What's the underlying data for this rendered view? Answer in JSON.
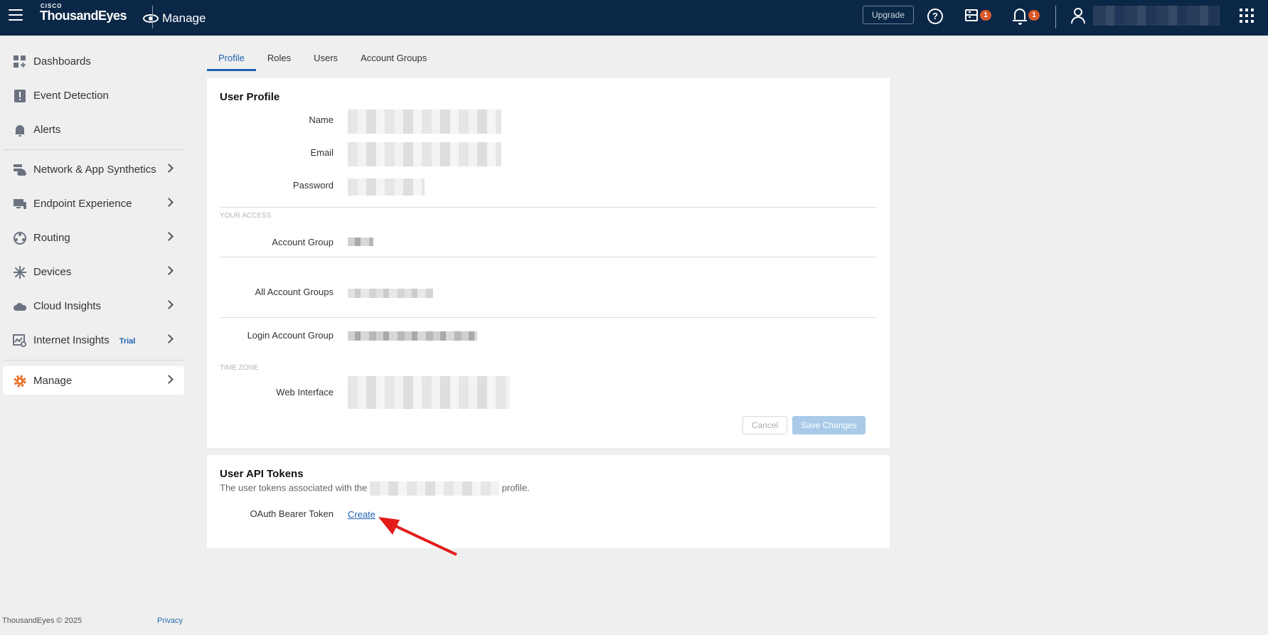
{
  "header": {
    "brand_small": "CISCO",
    "brand": "ThousandEyes",
    "app_title": "Manage",
    "upgrade_label": "Upgrade",
    "tasks_badge": "1",
    "alerts_badge": "1",
    "icons": [
      "menu-icon",
      "help-icon",
      "tasks-icon",
      "bell-icon",
      "user-icon",
      "apps-grid-icon"
    ]
  },
  "sidebar": {
    "items": [
      {
        "label": "Dashboards",
        "icon": "dashboard-icon"
      },
      {
        "label": "Event Detection",
        "icon": "event-detection-icon"
      },
      {
        "label": "Alerts",
        "icon": "bell-icon"
      },
      {
        "label": "Network & App Synthetics",
        "icon": "network-icon"
      },
      {
        "label": "Endpoint Experience",
        "icon": "endpoint-icon"
      },
      {
        "label": "Routing",
        "icon": "routing-icon"
      },
      {
        "label": "Devices",
        "icon": "devices-icon"
      },
      {
        "label": "Cloud Insights",
        "icon": "cloud-icon"
      },
      {
        "label": "Internet Insights",
        "icon": "internet-insights-icon",
        "tag": "Trial"
      },
      {
        "label": "Manage",
        "icon": "gear-icon"
      }
    ],
    "footer_copyright": "ThousandEyes © 2025",
    "footer_privacy": "Privacy"
  },
  "tabs": [
    "Profile",
    "Roles",
    "Users",
    "Account Groups"
  ],
  "user_profile": {
    "title": "User Profile",
    "name_label": "Name",
    "email_label": "Email",
    "password_label": "Password",
    "your_access_caption": "YOUR ACCESS",
    "account_group_label": "Account Group",
    "all_account_groups_label": "All Account Groups",
    "login_account_group_label": "Login Account Group",
    "time_zone_caption": "TIME ZONE",
    "web_interface_label": "Web Interface",
    "cancel_label": "Cancel",
    "save_label": "Save Changes"
  },
  "api_tokens": {
    "title": "User API Tokens",
    "desc_prefix": "The user tokens associated with the",
    "desc_suffix": "profile.",
    "oauth_label": "OAuth Bearer Token",
    "create_label": "Create"
  },
  "colors": {
    "topbar": "#0b2747",
    "accent": "#1f62b0",
    "badge": "#d9582b",
    "annotation_arrow": "#e31b1b"
  }
}
